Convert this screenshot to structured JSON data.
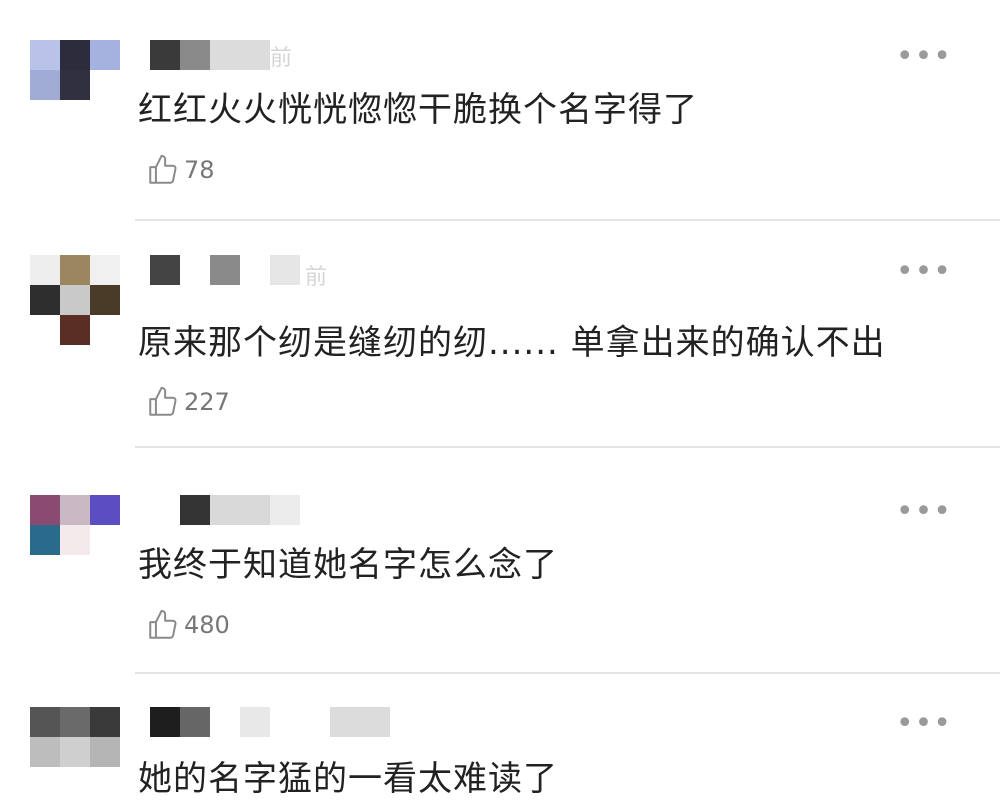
{
  "comments": [
    {
      "text": "红红火火恍恍惚惚干脆换个名字得了",
      "likes": "78",
      "name_fragment": "前"
    },
    {
      "text": "原来那个纫是缝纫的纫...... 单拿出来的确认不出",
      "likes": "227",
      "name_fragment": "前"
    },
    {
      "text": "我终于知道她名字怎么念了",
      "likes": "480",
      "name_fragment": ""
    },
    {
      "text": "她的名字猛的一看太难读了",
      "likes": "",
      "name_fragment": ""
    }
  ],
  "icons": {
    "more": "more-horizontal-icon",
    "like": "thumbs-up-icon"
  },
  "colors": {
    "text": "#222222",
    "meta": "#777777",
    "divider": "#e5e5e5"
  }
}
